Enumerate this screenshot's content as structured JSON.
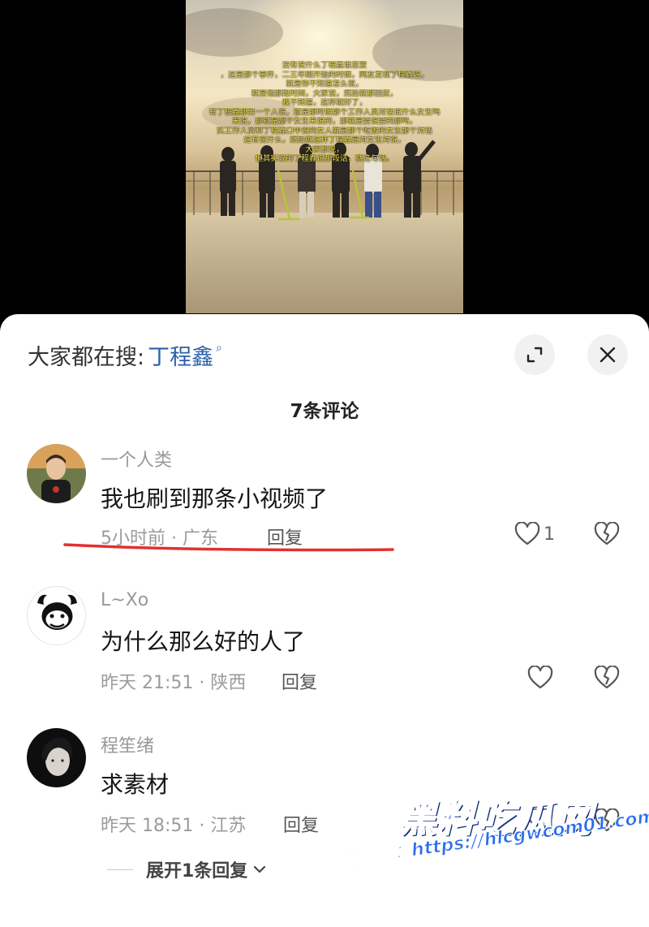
{
  "video": {
    "overlay_lines": [
      "没有说什么丁程鑫谁恋爱",
      "，这是那个事件，二三年刚开始的时候，网友发现丁程鑫说，",
      "就是你不知道怎么说，",
      "就是他那段时间，大家说，然后就那回应，",
      "我不知道，这样就好了，",
      "有丁程鑫那另一个人说，就是那时候那个工作人员对话说什么女生吗",
      "来说，那就是那个女生来说的，那就是要说要的那吗，",
      "实工作人员和丁程鑫口中说的女人就是那个吃饭的女生那个对话",
      "这有说什么，然后就这样丁程鑫是对女生对说，",
      "大家都说，",
      "但其实说的丁程鑫说那段话，就这句话。"
    ]
  },
  "header": {
    "search_label": "大家都在搜:",
    "search_term": "丁程鑫",
    "search_term_icon": "search-icon",
    "expand_icon": "expand-icon",
    "close_icon": "close-icon"
  },
  "comment_count": "7条评论",
  "comments": [
    {
      "user": "一个人类",
      "text": "我也刷到那条小视频了",
      "meta": "5小时前 · 广东",
      "reply": "回复",
      "likes": "1",
      "highlighted": true
    },
    {
      "user": "L~Xo",
      "text": "为什么那么好的人了",
      "meta": "昨天 21:51 · 陕西",
      "reply": "回复",
      "likes": ""
    },
    {
      "user": "程笙绪",
      "text": "求素材",
      "meta": "昨天 18:51 · 江苏",
      "reply": "回复",
      "likes": ""
    }
  ],
  "expand_replies": "展开1条回复",
  "watermark": {
    "title": "黑料吃瓜网",
    "subtitle": "看完整版：https://hlcgwcom01.com"
  },
  "colors": {
    "search_term": "#2a5fa8",
    "underline": "#e0322f",
    "watermark": "#2b6cf0"
  }
}
